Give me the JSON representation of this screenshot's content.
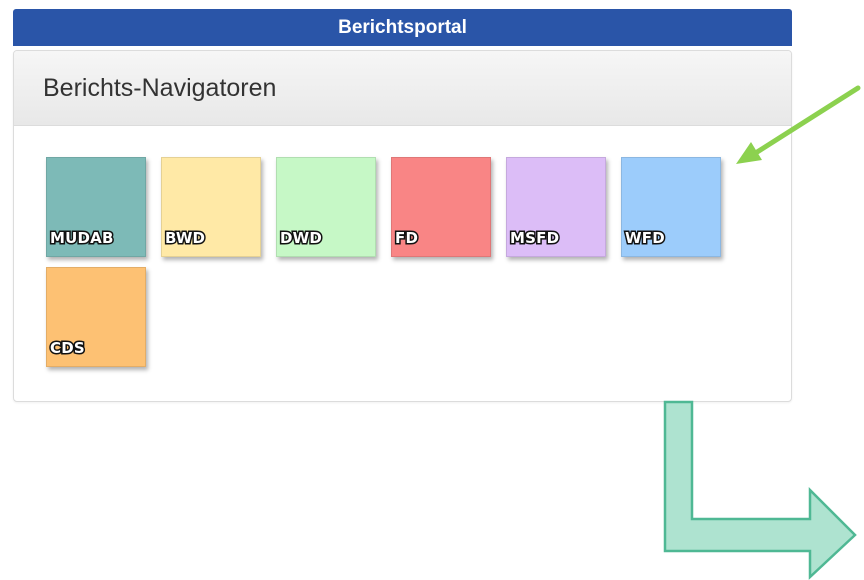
{
  "header": {
    "title": "Berichtsportal"
  },
  "panel": {
    "title": "Berichts-Navigatoren"
  },
  "tiles": [
    {
      "label": "MUDAB",
      "color": "#7dbab7"
    },
    {
      "label": "BWD",
      "color": "#ffe9a6"
    },
    {
      "label": "DWD",
      "color": "#c6f8c6"
    },
    {
      "label": "FD",
      "color": "#f98585"
    },
    {
      "label": "MSFD",
      "color": "#dcbdf7"
    },
    {
      "label": "WFD",
      "color": "#9cccfb"
    },
    {
      "label": "CDS",
      "color": "#fdc173"
    }
  ],
  "annotations": {
    "green_arrow_color": "#8cd14f",
    "teal_arrow_fill": "#aee3d0",
    "teal_arrow_stroke": "#4fb894"
  }
}
